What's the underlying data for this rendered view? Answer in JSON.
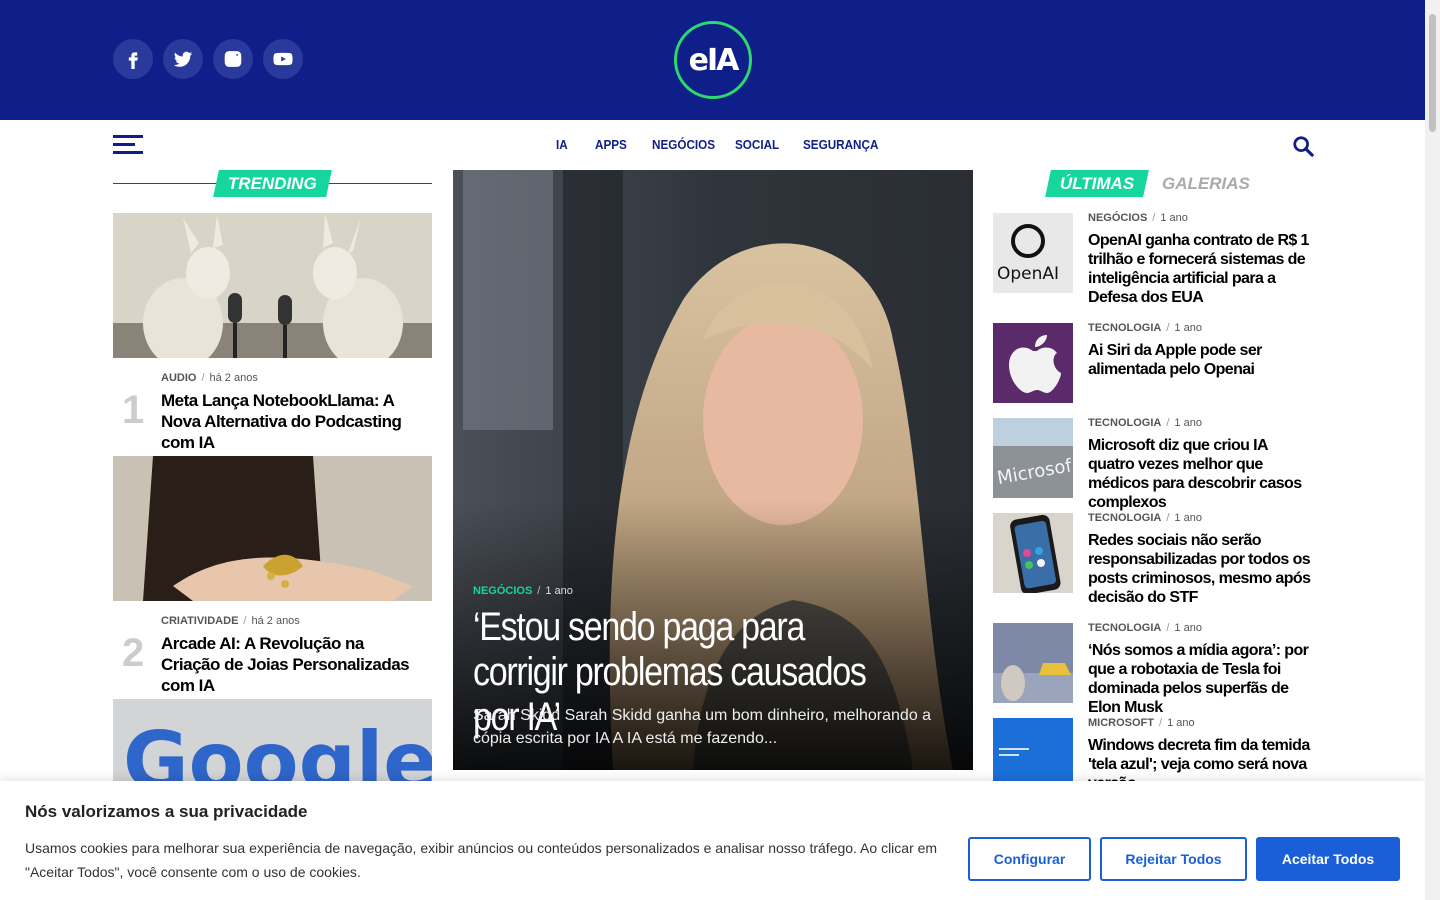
{
  "brand": {
    "logo_text": "eIA",
    "colors": {
      "primary": "#0f1f8a",
      "accent": "#16d6a0",
      "button": "#1a5fd8",
      "logo_ring": "#2bd96d"
    }
  },
  "social_icons": [
    "facebook-icon",
    "twitter-icon",
    "instagram-icon",
    "youtube-icon"
  ],
  "nav": {
    "items": [
      "IA",
      "APPS",
      "NEGÓCIOS",
      "SOCIAL",
      "SEGURANÇA"
    ]
  },
  "trending": {
    "label": "TRENDING",
    "items": [
      {
        "num": "1",
        "category": "AUDIO",
        "time": "há 2 anos",
        "title": "Meta Lança NotebookLlama: A Nova Alternativa do Podcasting com IA"
      },
      {
        "num": "2",
        "category": "CRIATIVIDADE",
        "time": "há 2 anos",
        "title": "Arcade AI: A Revolução na Criação de Joias Personalizadas com IA"
      },
      {
        "image_text": "Google"
      }
    ]
  },
  "hero": {
    "category": "NEGÓCIOS",
    "time": "1 ano",
    "title": "‘Estou sendo paga para corrigir problemas causados por IA’",
    "excerpt": "Sarah Skidd Sarah Skidd ganha um bom dinheiro, melhorando a cópia escrita por IA A IA está me fazendo..."
  },
  "latest": {
    "tab_active": "ÚLTIMAS",
    "tab_inactive": "GALERIAS",
    "items": [
      {
        "category": "NEGÓCIOS",
        "time": "1 ano",
        "title": "OpenAI ganha contrato de R$ 1 trilhão e fornecerá sistemas de inteligência artificial para a Defesa dos EUA",
        "thumb_text": "OpenAI"
      },
      {
        "category": "TECNOLOGIA",
        "time": "1 ano",
        "title": "Ai Siri da Apple pode ser alimentada pelo Openai"
      },
      {
        "category": "TECNOLOGIA",
        "time": "1 ano",
        "title": "Microsoft diz que criou IA quatro vezes melhor que médicos para descobrir casos complexos",
        "thumb_text": "Microsof"
      },
      {
        "category": "TECNOLOGIA",
        "time": "1 ano",
        "title": "Redes sociais não serão responsabilizadas por todos os posts criminosos, mesmo após decisão do STF"
      },
      {
        "category": "TECNOLOGIA",
        "time": "1 ano",
        "title": "‘Nós somos a mídia agora’: por que a robotaxia de Tesla foi dominada pelos superfãs de Elon Musk"
      },
      {
        "category": "MICROSOFT",
        "time": "1 ano",
        "title": "Windows decreta fim da temida 'tela azul'; veja como será nova versão"
      }
    ]
  },
  "cookie": {
    "title": "Nós valorizamos a sua privacidade",
    "text": "Usamos cookies para melhorar sua experiência de navegação, exibir anúncios ou conteúdos personalizados e analisar nosso tráfego. Ao clicar em \"Aceitar Todos\", você consente com o uso de cookies.",
    "configure": "Configurar",
    "reject": "Rejeitar Todos",
    "accept": "Aceitar Todos"
  }
}
